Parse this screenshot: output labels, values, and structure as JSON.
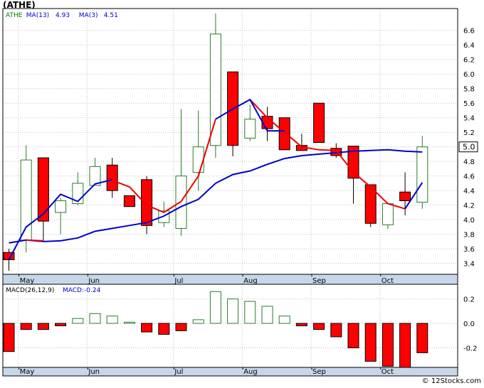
{
  "title": "(ATHE)",
  "credit": "© 12Stocks.com",
  "chart_data": [
    {
      "type": "candlestick",
      "ticker": "ATHE",
      "legend": [
        {
          "label": "ATHE",
          "color": "#008000"
        },
        {
          "label": "MA(13)",
          "value": "4.93",
          "color": "#0000cc"
        },
        {
          "label": "MA(3)",
          "value": "4.51",
          "color": "#0000cc"
        }
      ],
      "last_price_label": "5.0",
      "ylim": [
        3.25,
        6.9
      ],
      "yticks": [
        "3.4",
        "3.6",
        "3.8",
        "4.0",
        "4.2",
        "4.4",
        "4.6",
        "4.8",
        "5.0",
        "5.2",
        "5.4",
        "5.6",
        "5.8",
        "6.0",
        "6.2",
        "6.4",
        "6.6"
      ],
      "xlabels": [
        {
          "label": "May",
          "index": 1
        },
        {
          "label": "Jun",
          "index": 5
        },
        {
          "label": "Jul",
          "index": 10
        },
        {
          "label": "Aug",
          "index": 14
        },
        {
          "label": "Sep",
          "index": 18
        },
        {
          "label": "Oct",
          "index": 22
        }
      ],
      "candles": [
        {
          "o": 3.55,
          "h": 3.6,
          "l": 3.3,
          "c": 3.45
        },
        {
          "o": 3.72,
          "h": 5.02,
          "l": 3.55,
          "c": 4.82
        },
        {
          "o": 4.85,
          "h": 4.85,
          "l": 3.7,
          "c": 3.98
        },
        {
          "o": 4.1,
          "h": 4.3,
          "l": 3.8,
          "c": 4.26
        },
        {
          "o": 4.22,
          "h": 4.65,
          "l": 4.2,
          "c": 4.5
        },
        {
          "o": 4.47,
          "h": 4.85,
          "l": 4.47,
          "c": 4.73
        },
        {
          "o": 4.75,
          "h": 4.85,
          "l": 4.3,
          "c": 4.4
        },
        {
          "o": 4.33,
          "h": 4.33,
          "l": 4.18,
          "c": 4.18
        },
        {
          "o": 4.55,
          "h": 4.6,
          "l": 3.8,
          "c": 3.92
        },
        {
          "o": 3.96,
          "h": 4.25,
          "l": 3.9,
          "c": 4.12
        },
        {
          "o": 3.88,
          "h": 5.52,
          "l": 3.78,
          "c": 4.6
        },
        {
          "o": 4.65,
          "h": 5.5,
          "l": 4.4,
          "c": 5.0
        },
        {
          "o": 5.02,
          "h": 6.83,
          "l": 4.85,
          "c": 6.55
        },
        {
          "o": 6.03,
          "h": 6.03,
          "l": 4.87,
          "c": 5.02
        },
        {
          "o": 5.12,
          "h": 5.58,
          "l": 5.08,
          "c": 5.38
        },
        {
          "o": 5.42,
          "h": 5.55,
          "l": 5.08,
          "c": 5.25
        },
        {
          "o": 5.4,
          "h": 5.4,
          "l": 4.96,
          "c": 4.96
        },
        {
          "o": 5.02,
          "h": 5.18,
          "l": 4.95,
          "c": 4.95
        },
        {
          "o": 5.6,
          "h": 5.6,
          "l": 5.06,
          "c": 5.06
        },
        {
          "o": 4.98,
          "h": 5.05,
          "l": 4.85,
          "c": 4.88
        },
        {
          "o": 5.01,
          "h": 5.01,
          "l": 4.22,
          "c": 4.57
        },
        {
          "o": 4.48,
          "h": 4.48,
          "l": 3.9,
          "c": 3.95
        },
        {
          "o": 3.93,
          "h": 4.2,
          "l": 3.87,
          "c": 4.22
        },
        {
          "o": 4.38,
          "h": 4.65,
          "l": 4.06,
          "c": 4.26
        },
        {
          "o": 4.24,
          "h": 5.15,
          "l": 4.15,
          "c": 5.0
        }
      ],
      "ma13": [
        3.68,
        3.72,
        3.7,
        3.71,
        3.75,
        3.84,
        3.88,
        3.92,
        3.96,
        4.05,
        4.18,
        4.28,
        4.5,
        4.62,
        4.67,
        4.76,
        4.84,
        4.88,
        4.9,
        4.92,
        4.94,
        4.95,
        4.96,
        4.94,
        4.93
      ],
      "ma3": [
        3.45,
        3.9,
        4.08,
        4.35,
        4.25,
        4.49,
        4.55,
        null,
        null,
        null,
        null,
        null,
        5.38,
        5.52,
        5.65,
        5.22,
        5.22,
        null,
        null,
        null,
        null,
        null,
        null,
        4.15,
        4.51
      ],
      "ma3_red_segments": [
        [
          1,
          2
        ],
        [
          6,
          12
        ],
        [
          14,
          23
        ]
      ]
    },
    {
      "type": "bar",
      "title": "MACD(26,12,9)",
      "macd_label": "MACD:-0.24",
      "ylim": [
        -0.36,
        0.32
      ],
      "yticks": [
        "0.2",
        "0.0",
        "-0.2"
      ],
      "values": [
        -0.23,
        -0.05,
        -0.05,
        -0.02,
        0.04,
        0.08,
        0.06,
        0.01,
        -0.07,
        -0.09,
        -0.06,
        0.03,
        0.26,
        0.2,
        0.18,
        0.14,
        0.06,
        -0.02,
        -0.05,
        -0.11,
        -0.2,
        -0.31,
        -0.35,
        -0.37,
        -0.24
      ]
    }
  ]
}
